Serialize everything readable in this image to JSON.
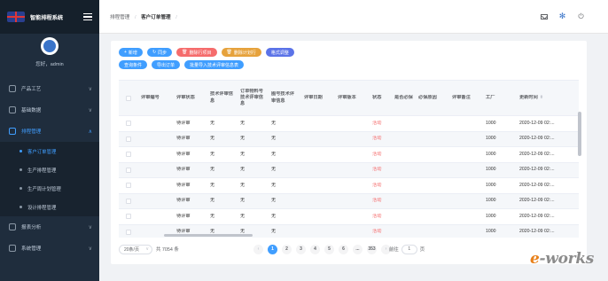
{
  "app": {
    "title": "智能排程系统",
    "user_greeting": "您好，admin"
  },
  "sidebar": {
    "items": [
      {
        "label": "产品工艺",
        "icon": "gear-icon",
        "chevron": "∨"
      },
      {
        "label": "基础数据",
        "icon": "sliders-icon",
        "chevron": "∨"
      },
      {
        "label": "排程管理",
        "icon": "stack-icon",
        "chevron": "∧"
      },
      {
        "label": "报表分析",
        "icon": "chart-icon",
        "chevron": "∨"
      },
      {
        "label": "系统管理",
        "icon": "settings-icon",
        "chevron": "∨"
      }
    ],
    "sub_items": [
      {
        "label": "客户订单管理"
      },
      {
        "label": "生产排程管理"
      },
      {
        "label": "生产周计划管理"
      },
      {
        "label": "设计排程管理"
      }
    ]
  },
  "header": {
    "breadcrumb": [
      "排程管理",
      "客户订单管理"
    ],
    "separator": "/",
    "icons": [
      "mail-icon",
      "global-icon",
      "power-icon"
    ]
  },
  "toolbar": {
    "row1": [
      {
        "label": "新增",
        "icon": "+",
        "color": "#409eff"
      },
      {
        "label": "同步",
        "icon": "↻",
        "color": "#409eff"
      },
      {
        "label": "删除行项目",
        "icon": "🗑",
        "color": "#f56c6c"
      },
      {
        "label": "删除计划行",
        "icon": "🗑",
        "color": "#e6a23c"
      },
      {
        "label": "格式调整",
        "icon": "",
        "color": "#5b73e8"
      }
    ],
    "row2": [
      {
        "label": "查询条件",
        "color": "#409eff"
      },
      {
        "label": "导出订单",
        "color": "#409eff"
      },
      {
        "label": "批量导入技术评审信息表",
        "color": "#409eff"
      }
    ]
  },
  "table": {
    "headers": [
      "",
      "评审编号",
      "评审状态",
      "技术评审信息",
      "订单物料号技术评审信息",
      "图号技术评审信息",
      "评审日期",
      "评审版本",
      "状态",
      "是否必保",
      "必保原因",
      "评审备注",
      "工厂",
      "更新时间"
    ],
    "rows": [
      [
        "",
        "",
        "待评审",
        "无",
        "无",
        "无",
        "",
        "",
        "活动",
        "",
        "",
        "",
        "1000",
        "2020-12-09 02:..."
      ],
      [
        "",
        "",
        "待评审",
        "无",
        "无",
        "无",
        "",
        "",
        "活动",
        "",
        "",
        "",
        "1000",
        "2020-12-09 02:..."
      ],
      [
        "",
        "",
        "待评审",
        "无",
        "无",
        "无",
        "",
        "",
        "活动",
        "",
        "",
        "",
        "1000",
        "2020-12-09 02:..."
      ],
      [
        "",
        "",
        "待评审",
        "无",
        "无",
        "无",
        "",
        "",
        "活动",
        "",
        "",
        "",
        "1000",
        "2020-12-09 02:..."
      ],
      [
        "",
        "",
        "待评审",
        "无",
        "无",
        "无",
        "",
        "",
        "活动",
        "",
        "",
        "",
        "1000",
        "2020-12-09 02:..."
      ],
      [
        "",
        "",
        "待评审",
        "无",
        "无",
        "无",
        "",
        "",
        "活动",
        "",
        "",
        "",
        "1000",
        "2020-12-09 02:..."
      ],
      [
        "",
        "",
        "待评审",
        "无",
        "无",
        "无",
        "",
        "",
        "活动",
        "",
        "",
        "",
        "1000",
        "2020-12-09 02:..."
      ],
      [
        "",
        "",
        "待评审",
        "无",
        "无",
        "无",
        "",
        "",
        "活动",
        "",
        "",
        "",
        "1000",
        "2020-12-09 02:..."
      ]
    ],
    "sort_indicator": "⬍"
  },
  "pagination": {
    "page_size": "20条/页",
    "total": "共 7054 条",
    "pages": [
      "1",
      "2",
      "3",
      "4",
      "5",
      "6",
      "...",
      "353"
    ],
    "current_page": "1",
    "goto_label": "前往",
    "goto_value": "1",
    "page_unit": "页",
    "prev": "‹",
    "next": "›"
  },
  "watermark": {
    "text": "e-works"
  },
  "colors": {
    "sidebar_bg": "#1f2d3d",
    "accent": "#409eff",
    "danger": "#f56c6c",
    "warning": "#e6a23c"
  }
}
